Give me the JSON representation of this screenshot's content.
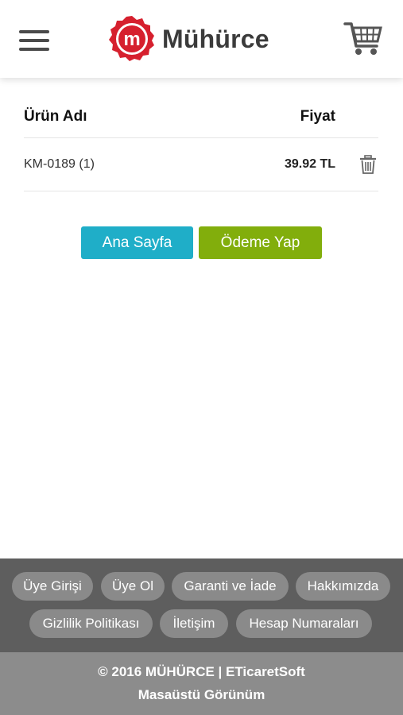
{
  "header": {
    "brand": "Mühürce",
    "menu_icon": "hamburger-menu-icon",
    "cart_icon": "shopping-cart-icon",
    "logo_icon": "seal-logo-icon"
  },
  "cart_table": {
    "headers": {
      "name": "Ürün Adı",
      "price": "Fiyat"
    },
    "rows": [
      {
        "name": "KM-0189 (1)",
        "price": "39.92 TL",
        "action_icon": "trash-icon"
      }
    ]
  },
  "buttons": {
    "home": "Ana Sayfa",
    "pay": "Ödeme Yap"
  },
  "footer": {
    "links": [
      "Üye Girişi",
      "Üye Ol",
      "Garanti ve İade",
      "Hakkımızda",
      "Gizlilik Politikası",
      "İletişim",
      "Hesap Numaraları"
    ],
    "copyright": "© 2016 MÜHÜRCE  |  ETicaretSoft",
    "desktop_view": "Masaüstü Görünüm"
  },
  "colors": {
    "brand_red": "#d6202e",
    "home_button": "#1faec8",
    "pay_button": "#82ae0c",
    "footer_dark": "#5e5e5e",
    "footer_light": "#8c8c8c"
  }
}
